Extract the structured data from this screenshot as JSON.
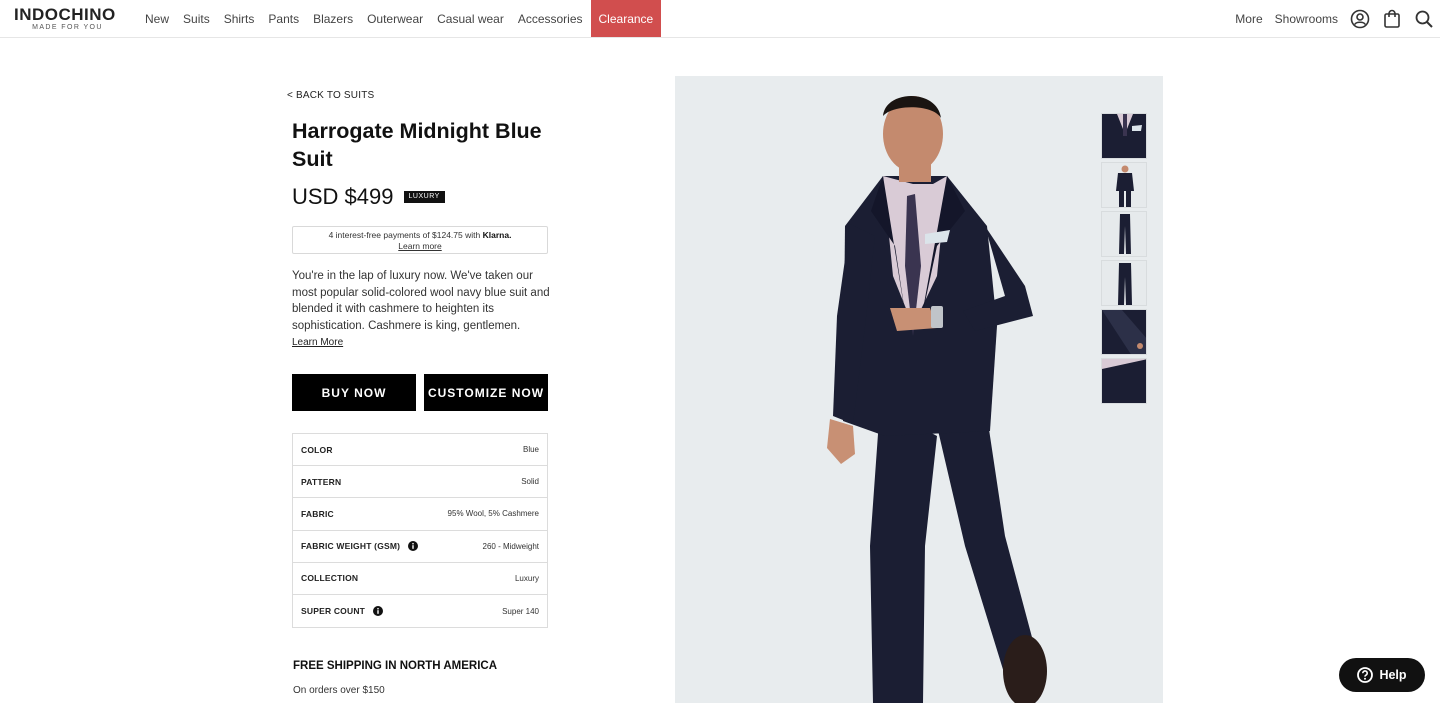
{
  "brand": {
    "name": "INDOCHINO",
    "tagline": "MADE FOR YOU"
  },
  "nav": {
    "items": [
      "New",
      "Suits",
      "Shirts",
      "Pants",
      "Blazers",
      "Outerwear",
      "Casual wear",
      "Accessories"
    ],
    "clearance": "Clearance",
    "more": "More",
    "showrooms": "Showrooms",
    "icons": [
      "account-icon",
      "shopping-bag-icon",
      "search-icon"
    ]
  },
  "product": {
    "back_link": "< BACK TO SUITS",
    "title": "Harrogate Midnight Blue Suit",
    "price": "USD $499",
    "badge": "LUXURY",
    "klarna": {
      "text": "4 interest-free payments of $124.75 with",
      "brand": "Klarna.",
      "learn": "Learn more"
    },
    "description": "You're in the lap of luxury now. We've taken our most popular solid-colored wool navy blue suit and blended it with cashmere to heighten its sophistication. Cashmere is king, gentlemen.",
    "learn_more": "Learn More",
    "buy_button": "BUY NOW",
    "customize_button": "CUSTOMIZE NOW",
    "specs": [
      {
        "label": "COLOR",
        "value": "Blue"
      },
      {
        "label": "PATTERN",
        "value": "Solid"
      },
      {
        "label": "FABRIC",
        "value": "95% Wool, 5% Cashmere"
      },
      {
        "label": "FABRIC WEIGHT (GSM)",
        "value": "260 - Midweight",
        "info": true
      },
      {
        "label": "COLLECTION",
        "value": "Luxury"
      },
      {
        "label": "SUPER COUNT",
        "value": "Super 140",
        "info": true
      }
    ],
    "shipping_title": "FREE SHIPPING IN NORTH AMERICA",
    "shipping_sub": "On orders over $150"
  },
  "gallery": {
    "thumbnail_count": 6
  },
  "help": {
    "label": "Help"
  },
  "colors": {
    "clearance": "#d14e4e",
    "button": "#000000",
    "photo_bg": "#e8ecee",
    "suit": "#1b1e33"
  }
}
